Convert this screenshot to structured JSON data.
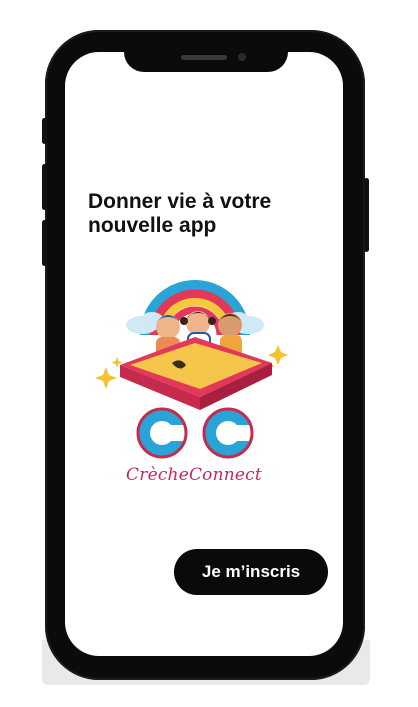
{
  "screen": {
    "headline": "Donner vie à votre nouvelle app",
    "brand_name": "CrècheConnect",
    "cta_label": "Je m’inscris"
  },
  "icons": [
    "creche-connect-logo-icon",
    "sparkle-icon"
  ],
  "colors": {
    "phone_frame": "#0b0b0b",
    "screen_bg": "#ffffff",
    "cta_bg": "#0a0a0a",
    "cta_text": "#ffffff",
    "brand_pink": "#c6285d",
    "brand_blue": "#2aa3d6",
    "rainbow_red": "#e2385a",
    "rainbow_yellow": "#f6c93b"
  }
}
